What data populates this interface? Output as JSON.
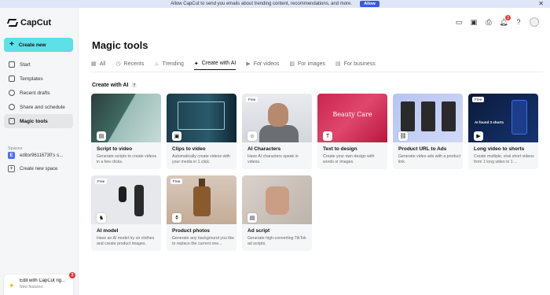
{
  "banner": {
    "text": "Allow CapCut to send you emails about trending content, recommendations, and more.",
    "allow_label": "Allow",
    "close_icon": "close-icon"
  },
  "sidebar": {
    "logo_text": "CapCut",
    "create_label": "Create new",
    "items": [
      {
        "label": "Start",
        "icon": "home-icon",
        "active": false
      },
      {
        "label": "Templates",
        "icon": "templates-icon",
        "active": false
      },
      {
        "label": "Recent drafts",
        "icon": "clock-icon",
        "active": false
      },
      {
        "label": "Share and schedule",
        "icon": "share-icon",
        "active": false
      },
      {
        "label": "Magic tools",
        "icon": "magic-icon",
        "active": true
      }
    ],
    "spaces_label": "Spaces",
    "space_name": "editor96116730's s...",
    "space_avatar_letter": "E",
    "create_space_label": "Create new space",
    "promo": {
      "title": "Edit with CapCut rig...",
      "subtitle": "New features",
      "badge": "3"
    }
  },
  "header": {
    "notification_count": "2"
  },
  "main": {
    "title": "Magic tools",
    "tabs": [
      {
        "label": "All",
        "icon": "grid-icon",
        "active": false
      },
      {
        "label": "Recents",
        "icon": "clock-icon",
        "active": false
      },
      {
        "label": "Trending",
        "icon": "flame-icon",
        "active": false
      },
      {
        "label": "Create with AI",
        "icon": "sparkle-icon",
        "active": true
      },
      {
        "label": "For videos",
        "icon": "video-icon",
        "active": false
      },
      {
        "label": "For images",
        "icon": "image-icon",
        "active": false
      },
      {
        "label": "For business",
        "icon": "briefcase-icon",
        "active": false
      }
    ],
    "section_title": "Create with AI",
    "section_help": "?",
    "cards": [
      {
        "title": "Script to video",
        "desc": "Generate scripts to create videos in a few clicks."
      },
      {
        "title": "Clips to video",
        "desc": "Automatically create videos with your media in 1 click."
      },
      {
        "title": "AI Characters",
        "desc": "Have AI characters speak in videos.",
        "badge": "Free"
      },
      {
        "title": "Text to design",
        "desc": "Create your own design with words or images.",
        "thumb_text": "Beauty Care"
      },
      {
        "title": "Product URL to Ads",
        "desc": "Generate video ads with a product link."
      },
      {
        "title": "Long video to shorts",
        "desc": "Create multiple, viral short videos from 1 long video in 1 ...",
        "badge": "Free",
        "thumb_text": "AI found 3 shorts"
      },
      {
        "title": "AI model",
        "desc": "Have an AI model try on clothes and create product images.",
        "badge": "Free"
      },
      {
        "title": "Product photos",
        "desc": "Generate any background you like to replace the current one...",
        "badge": "Free"
      },
      {
        "title": "Ad script",
        "desc": "Generate high-converting TikTok ad scripts."
      }
    ]
  }
}
